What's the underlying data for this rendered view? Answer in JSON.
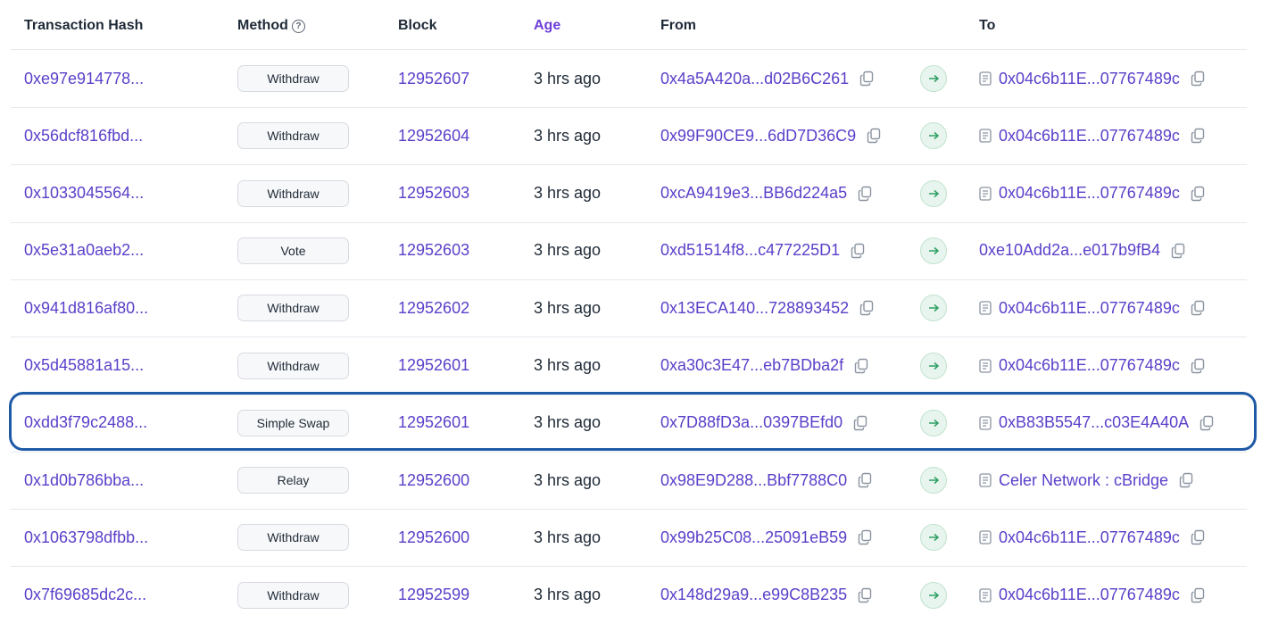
{
  "header": {
    "tx_hash": "Transaction Hash",
    "method": "Method",
    "block": "Block",
    "age": "Age",
    "from": "From",
    "to": "To"
  },
  "icons": {
    "help": "question-circle-icon",
    "copy": "copy-icon",
    "arrow": "arrow-right-icon",
    "contract": "contract-document-icon"
  },
  "colors": {
    "link": "#5b3fc9",
    "age_header": "#6d3fd9",
    "arrow_bg": "#e8f5ee",
    "arrow_fg": "#2f9e63",
    "highlight": "#1f5aa6"
  },
  "rows": [
    {
      "hash": "0xe97e914778...",
      "method": "Withdraw",
      "block": "12952607",
      "age": "3 hrs ago",
      "from": "0x4a5A420a...d02B6C261",
      "to": "0x04c6b11E...07767489c",
      "to_contract": true,
      "highlighted": false
    },
    {
      "hash": "0x56dcf816fbd...",
      "method": "Withdraw",
      "block": "12952604",
      "age": "3 hrs ago",
      "from": "0x99F90CE9...6dD7D36C9",
      "to": "0x04c6b11E...07767489c",
      "to_contract": true,
      "highlighted": false
    },
    {
      "hash": "0x1033045564...",
      "method": "Withdraw",
      "block": "12952603",
      "age": "3 hrs ago",
      "from": "0xcA9419e3...BB6d224a5",
      "to": "0x04c6b11E...07767489c",
      "to_contract": true,
      "highlighted": false
    },
    {
      "hash": "0x5e31a0aeb2...",
      "method": "Vote",
      "block": "12952603",
      "age": "3 hrs ago",
      "from": "0xd51514f8...c477225D1",
      "to": "0xe10Add2a...e017b9fB4",
      "to_contract": false,
      "highlighted": false
    },
    {
      "hash": "0x941d816af80...",
      "method": "Withdraw",
      "block": "12952602",
      "age": "3 hrs ago",
      "from": "0x13ECA140...728893452",
      "to": "0x04c6b11E...07767489c",
      "to_contract": true,
      "highlighted": false
    },
    {
      "hash": "0x5d45881a15...",
      "method": "Withdraw",
      "block": "12952601",
      "age": "3 hrs ago",
      "from": "0xa30c3E47...eb7BDba2f",
      "to": "0x04c6b11E...07767489c",
      "to_contract": true,
      "highlighted": false
    },
    {
      "hash": "0xdd3f79c2488...",
      "method": "Simple Swap",
      "block": "12952601",
      "age": "3 hrs ago",
      "from": "0x7D88fD3a...0397BEfd0",
      "to": "0xB83B5547...c03E4A40A",
      "to_contract": true,
      "highlighted": true
    },
    {
      "hash": "0x1d0b786bba...",
      "method": "Relay",
      "block": "12952600",
      "age": "3 hrs ago",
      "from": "0x98E9D288...Bbf7788C0",
      "to": "Celer Network : cBridge",
      "to_contract": true,
      "highlighted": false
    },
    {
      "hash": "0x1063798dfbb...",
      "method": "Withdraw",
      "block": "12952600",
      "age": "3 hrs ago",
      "from": "0x99b25C08...25091eB59",
      "to": "0x04c6b11E...07767489c",
      "to_contract": true,
      "highlighted": false
    },
    {
      "hash": "0x7f69685dc2c...",
      "method": "Withdraw",
      "block": "12952599",
      "age": "3 hrs ago",
      "from": "0x148d29a9...e99C8B235",
      "to": "0x04c6b11E...07767489c",
      "to_contract": true,
      "highlighted": false
    }
  ]
}
